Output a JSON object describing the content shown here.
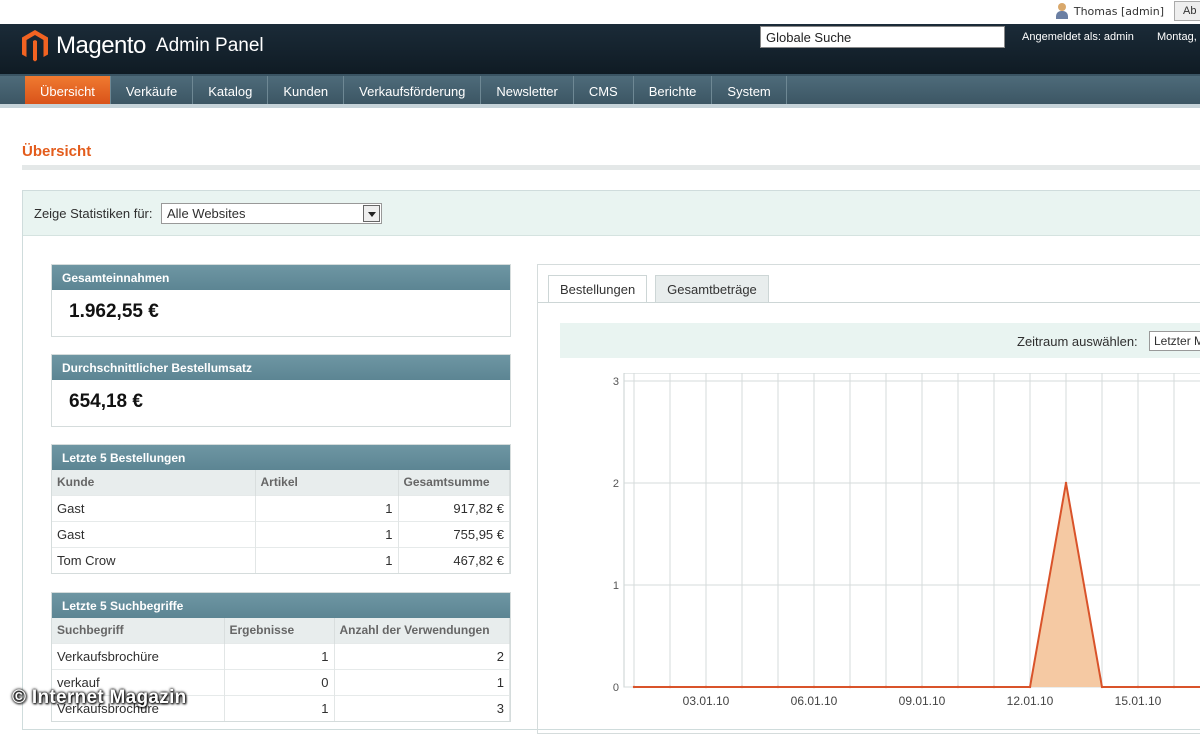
{
  "topbar": {
    "user": "Thomas [admin]",
    "logout_label": "Ab"
  },
  "header": {
    "logo_text": "Magento",
    "logo_sub": "Admin Panel",
    "search_value": "Globale Suche",
    "login_info": "Angemeldet als: admin",
    "date_text": "Montag,"
  },
  "nav": {
    "items": [
      "Übersicht",
      "Verkäufe",
      "Katalog",
      "Kunden",
      "Verkaufsförderung",
      "Newsletter",
      "CMS",
      "Berichte",
      "System"
    ],
    "active_index": 0
  },
  "page": {
    "title": "Übersicht",
    "filter_label": "Zeige Statistiken für:",
    "filter_value": "Alle Websites"
  },
  "revenue": {
    "title": "Gesamteinnahmen",
    "value": "1.962,55 €"
  },
  "avg_order": {
    "title": "Durchschnittlicher Bestellumsatz",
    "value": "654,18 €"
  },
  "orders": {
    "title": "Letzte 5 Bestellungen",
    "columns": [
      "Kunde",
      "Artikel",
      "Gesamtsumme"
    ],
    "rows": [
      [
        "Gast",
        "1",
        "917,82 €"
      ],
      [
        "Gast",
        "1",
        "755,95 €"
      ],
      [
        "Tom Crow",
        "1",
        "467,82 €"
      ]
    ]
  },
  "search_terms": {
    "title": "Letzte 5 Suchbegriffe",
    "columns": [
      "Suchbegriff",
      "Ergebnisse",
      "Anzahl der Verwendungen"
    ],
    "rows": [
      [
        "Verkaufsbrochüre",
        "1",
        "2"
      ],
      [
        "verkauf",
        "0",
        "1"
      ],
      [
        "Verkaufsbrochüre",
        "1",
        "3"
      ]
    ]
  },
  "chart_panel": {
    "tabs": [
      "Bestellungen",
      "Gesamtbeträge"
    ],
    "active_tab": 0,
    "period_label": "Zeitraum auswählen:",
    "period_value": "Letzter Monat"
  },
  "chart_data": {
    "type": "area",
    "y_ticks": [
      "0",
      "1",
      "2",
      "3"
    ],
    "ylim": [
      0,
      3
    ],
    "x_tick_labels": [
      "03.01.10",
      "06.01.10",
      "09.01.10",
      "12.01.10",
      "15.01.10"
    ],
    "x_days": [
      31,
      32,
      33,
      34,
      35,
      36,
      37,
      38,
      39,
      40,
      41,
      42,
      43,
      44,
      45,
      46,
      47
    ],
    "values": [
      0,
      0,
      0,
      0,
      0,
      0,
      0,
      0,
      0,
      0,
      0,
      0,
      2,
      0,
      0,
      0,
      0
    ],
    "line_color": "#d9532a",
    "fill_color": "#f5c9a3",
    "grid": true
  },
  "watermark": "© Internet Magazin",
  "colors": {
    "accent": "#e35c1c",
    "header_bg": "#1b2b38",
    "nav_bg": "#4e6b7a",
    "panel_head": "#6e96a3"
  }
}
